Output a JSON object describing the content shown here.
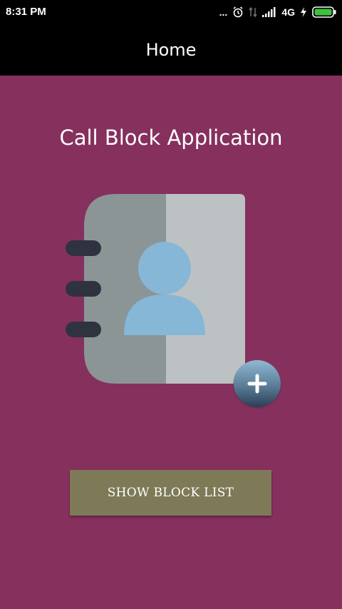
{
  "status_bar": {
    "time": "8:31 PM",
    "dots": "...",
    "network_type": "4G",
    "icons": [
      "alarm-icon",
      "data-transfer-icon",
      "signal-icon",
      "charging-icon",
      "battery-icon"
    ]
  },
  "app_bar": {
    "title": "Home"
  },
  "main": {
    "heading": "Call Block Application",
    "illustration_icon": "contact-book-add-icon",
    "show_block_list_button": "SHOW BLOCK LIST"
  },
  "colors": {
    "background": "#86305e",
    "app_bar": "#000000",
    "button": "#7e7a57",
    "book_left": "#8b9596",
    "book_right": "#bcc2c3",
    "person": "#87b7d6",
    "rings": "#2f3340"
  }
}
